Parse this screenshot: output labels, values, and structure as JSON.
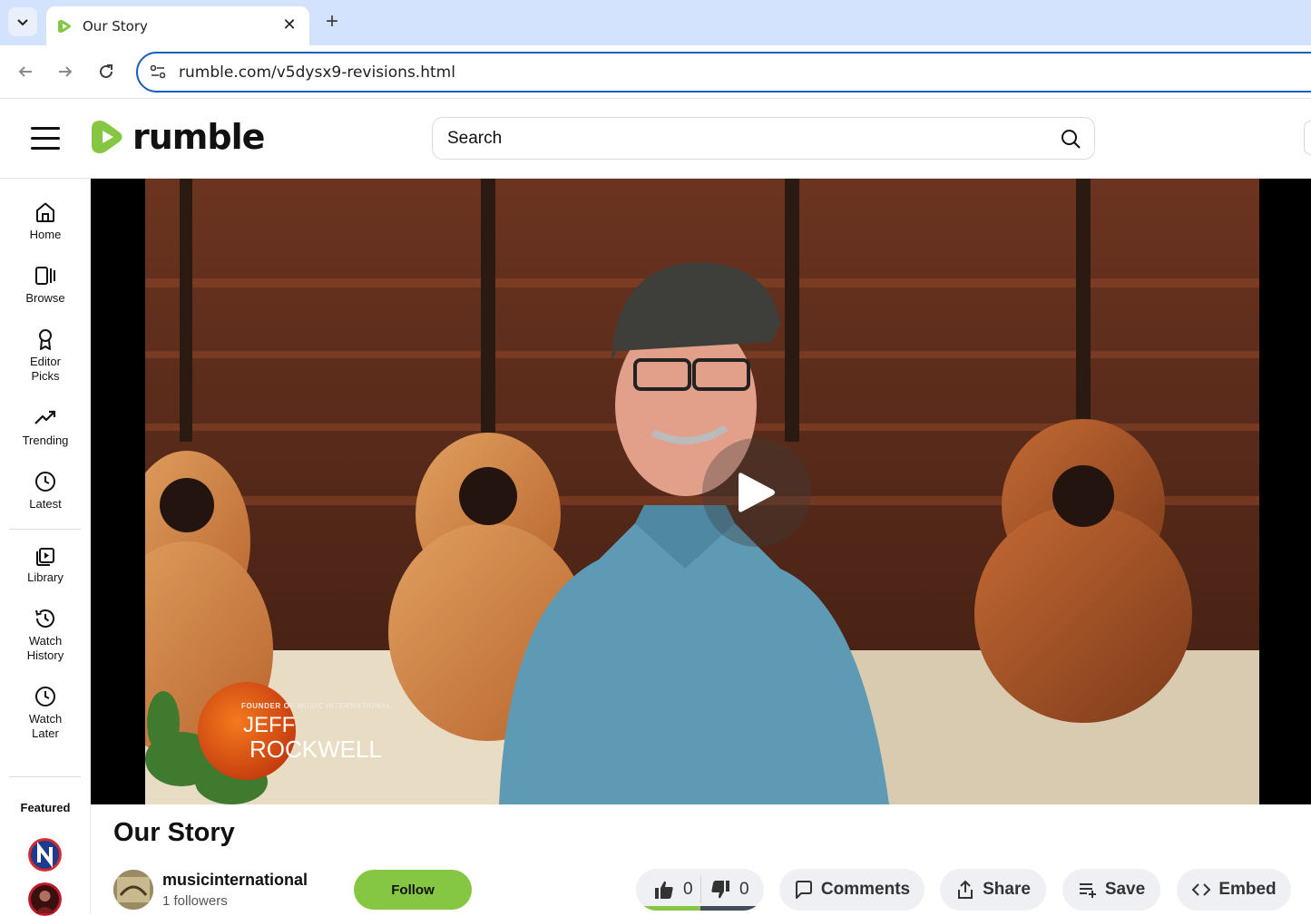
{
  "browser": {
    "tab_title": "Our Story",
    "url": "rumble.com/v5dysx9-revisions.html"
  },
  "header": {
    "logo_text": "rumble",
    "search_placeholder": "Search"
  },
  "sidebar": {
    "items": [
      {
        "label": "Home",
        "icon": "home-icon"
      },
      {
        "label": "Browse",
        "icon": "browse-icon"
      },
      {
        "label": "Editor Picks",
        "icon": "award-ribbon-icon"
      },
      {
        "label": "Trending",
        "icon": "trending-up-icon"
      },
      {
        "label": "Latest",
        "icon": "clock-icon"
      },
      {
        "label": "Library",
        "icon": "library-play-icon"
      },
      {
        "label": "Watch History",
        "icon": "history-icon"
      },
      {
        "label": "Watch Later",
        "icon": "clock-icon"
      }
    ],
    "featured_title": "Featured"
  },
  "video": {
    "lower_third_small": "FOUNDER OF MUSIC INTERNATIONAL",
    "lower_third_name1": "JEFF",
    "lower_third_name2": "ROCKWELL",
    "title": "Our Story"
  },
  "channel": {
    "name": "musicinternational",
    "followers": "1 followers",
    "follow_label": "Follow"
  },
  "actions": {
    "likes": "0",
    "dislikes": "0",
    "comments_label": "Comments",
    "share_label": "Share",
    "save_label": "Save",
    "embed_label": "Embed"
  },
  "colors": {
    "brand_green": "#85c742",
    "omnibox_border": "#1a5fbf",
    "tabbar": "#d3e3fd"
  }
}
